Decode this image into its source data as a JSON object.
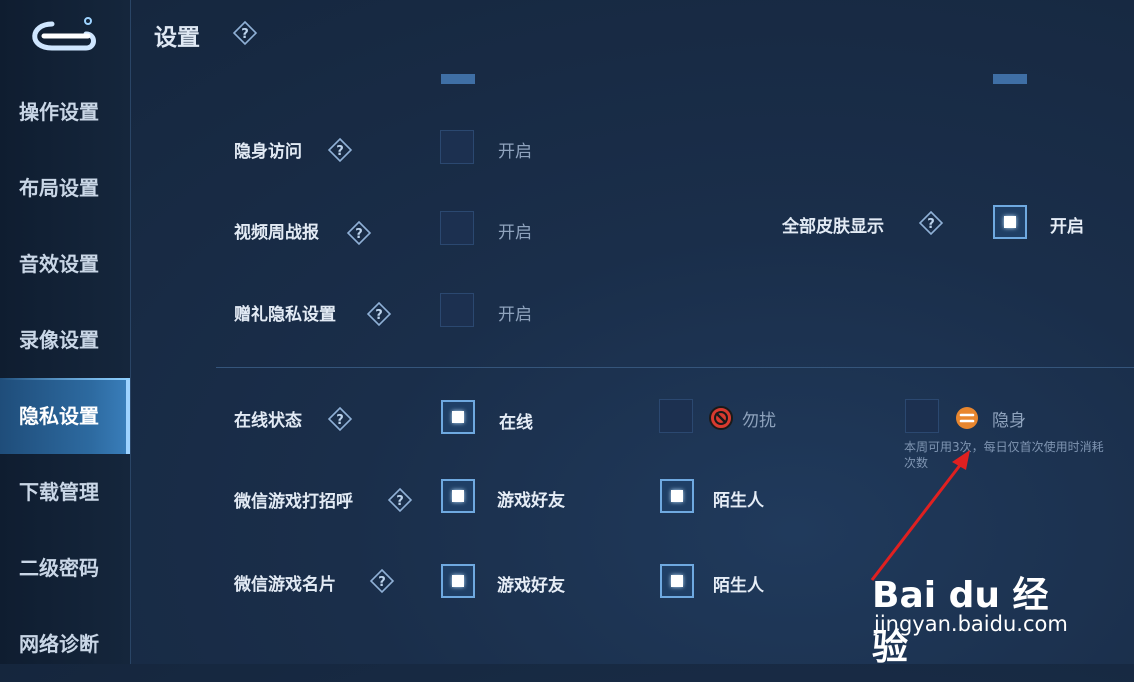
{
  "header": {
    "title": "设置"
  },
  "sidebar": {
    "items": [
      {
        "label": "操作设置"
      },
      {
        "label": "布局设置"
      },
      {
        "label": "音效设置"
      },
      {
        "label": "录像设置"
      },
      {
        "label": "隐私设置",
        "active": true
      },
      {
        "label": "下载管理"
      },
      {
        "label": "二级密码"
      },
      {
        "label": "网络诊断"
      }
    ]
  },
  "privacy": {
    "hidden_visit": {
      "label": "隐身访问",
      "option": "开启",
      "checked": false
    },
    "video_weekly": {
      "label": "视频周战报",
      "option": "开启",
      "checked": false
    },
    "gift_privacy": {
      "label": "赠礼隐私设置",
      "option": "开启",
      "checked": false
    },
    "all_skins": {
      "label": "全部皮肤显示",
      "option": "开启",
      "checked": true
    },
    "online_status": {
      "label": "在线状态",
      "online": "在线",
      "dnd": "勿扰",
      "invisible": "隐身",
      "hint": "本周可用3次，每日仅首次使用时消耗次数"
    },
    "wechat_greet": {
      "label": "微信游戏打招呼",
      "friends": "游戏好友",
      "strangers": "陌生人"
    },
    "wechat_card": {
      "label": "微信游戏名片",
      "friends": "游戏好友",
      "strangers": "陌生人"
    }
  },
  "watermark": {
    "logo": "Bai du 经验",
    "url": "jingyan.baidu.com"
  },
  "colors": {
    "accent": "#6fa9e0",
    "active_nav": "#2d6aa0",
    "dnd_red": "#d93a2f",
    "invisible_orange": "#e8862e"
  }
}
